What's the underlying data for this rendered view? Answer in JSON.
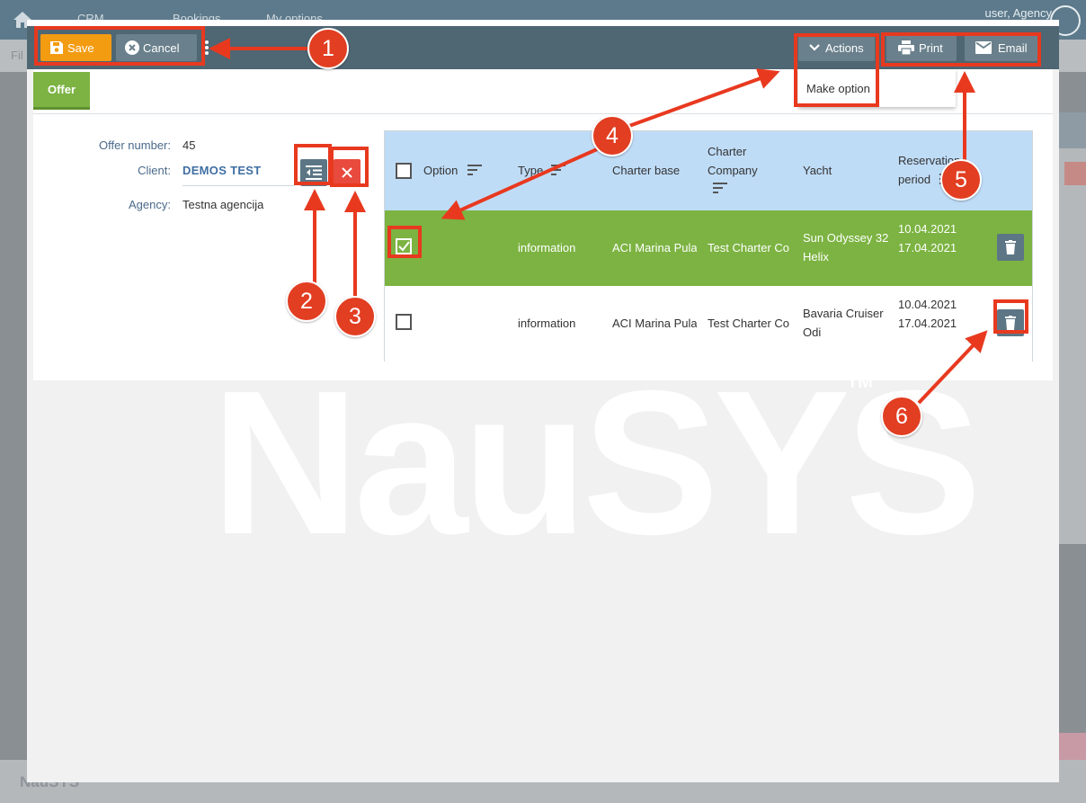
{
  "background": {
    "nav_items": [
      "CRM",
      "Bookings",
      "My options"
    ],
    "user": "user, Agency",
    "filter_label": "Fil",
    "footer_logo": "NauSYS"
  },
  "toolbar": {
    "save_label": "Save",
    "cancel_label": "Cancel",
    "actions_label": "Actions",
    "print_label": "Print",
    "email_label": "Email"
  },
  "actions_menu": {
    "items": [
      "Make option"
    ]
  },
  "tabs": [
    {
      "label": "Offer",
      "active": true
    }
  ],
  "offer": {
    "number_label": "Offer number:",
    "number_value": "45",
    "client_label": "Client:",
    "client_value": "DEMOS TEST",
    "agency_label": "Agency:",
    "agency_value": "Testna agencija"
  },
  "table": {
    "headers": {
      "option": "Option",
      "type": "Type",
      "charter_base": "Charter base",
      "charter_company_line1": "Charter",
      "charter_company_line2": "Company",
      "yacht": "Yacht",
      "reservation_line1": "Reservation",
      "reservation_line2": "period"
    },
    "rows": [
      {
        "checked": true,
        "type": "information",
        "charter_base": "ACI Marina Pula",
        "charter_company": "Test Charter Co",
        "yacht_line1": "Sun Odyssey 32",
        "yacht_line2": "Helix",
        "date_from": "10.04.2021",
        "date_to": "17.04.2021"
      },
      {
        "checked": false,
        "type": "information",
        "charter_base": "ACI Marina Pula",
        "charter_company": "Test Charter Co",
        "yacht_line1": "Bavaria Cruiser",
        "yacht_line2": "Odi",
        "date_from": "10.04.2021",
        "date_to": "17.04.2021"
      }
    ]
  },
  "watermark": {
    "text": "NauSYS",
    "tm": "TM"
  },
  "annotations": [
    "1",
    "2",
    "3",
    "4",
    "5",
    "6"
  ],
  "colors": {
    "toolbar": "#4f6673",
    "save": "#f39c12",
    "button": "#6a808c",
    "selected_row": "#7cb342",
    "header_row": "#bfdcf7",
    "annotation": "#e8391f"
  }
}
